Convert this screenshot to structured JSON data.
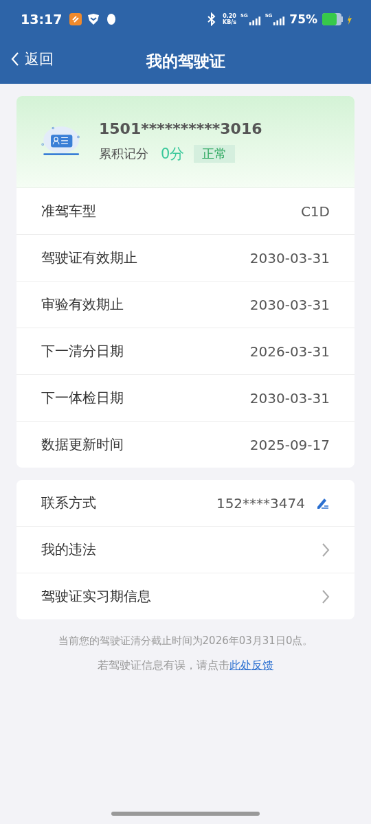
{
  "status_bar": {
    "time": "13:17",
    "net_speed": "0.20",
    "net_unit": "KB/s",
    "signal_1": "5G",
    "signal_2": "5G",
    "battery": "75%"
  },
  "header": {
    "back": "返回",
    "title": "我的驾驶证"
  },
  "license": {
    "number": "1501**********3016",
    "points_label": "累积记分",
    "points": "0分",
    "status": "正常"
  },
  "details": [
    {
      "label": "准驾车型",
      "value": "C1D"
    },
    {
      "label": "驾驶证有效期止",
      "value": "2030-03-31"
    },
    {
      "label": "审验有效期止",
      "value": "2030-03-31"
    },
    {
      "label": "下一清分日期",
      "value": "2026-03-31"
    },
    {
      "label": "下一体检日期",
      "value": "2030-03-31"
    },
    {
      "label": "数据更新时间",
      "value": "2025-09-17"
    }
  ],
  "menu": [
    {
      "kind": "edit",
      "label": "联系方式",
      "value": "152****3474"
    },
    {
      "kind": "link",
      "label": "我的违法"
    },
    {
      "kind": "link",
      "label": "驾驶证实习期信息"
    }
  ],
  "notice": "当前您的驾驶证清分截止时间为2026年03月31日0点。",
  "feedback": {
    "text": "若驾驶证信息有误，请点击",
    "link": "此处反馈"
  }
}
